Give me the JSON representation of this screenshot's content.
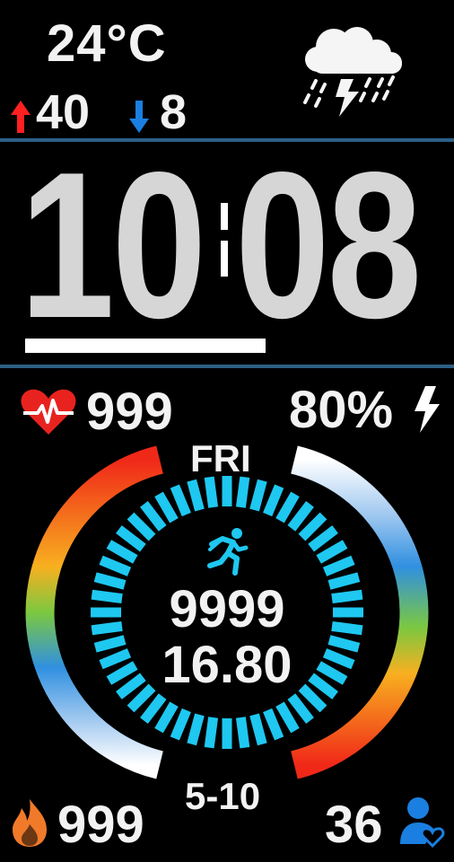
{
  "weather": {
    "temperature": "24°C",
    "high": "40",
    "low": "8",
    "condition_icon": "thunderstorm-icon",
    "high_color": "#ff2020",
    "low_color": "#1a7fe0"
  },
  "time": {
    "hour": "10",
    "minute": "08"
  },
  "heart_rate": {
    "value": "999",
    "icon": "heart-rate-icon",
    "color": "#e8231f"
  },
  "battery": {
    "value": "80%",
    "icon": "lightning-icon"
  },
  "date": {
    "weekday": "FRI",
    "day": "5-10"
  },
  "activity": {
    "steps": "9999",
    "distance": "16.80",
    "icon": "running-icon",
    "accent": "#1ec8f0"
  },
  "calories": {
    "value": "999",
    "icon": "flame-icon",
    "color": "#f07a2a"
  },
  "friends": {
    "value": "36",
    "icon": "person-heart-icon",
    "color": "#1a7fe0"
  }
}
